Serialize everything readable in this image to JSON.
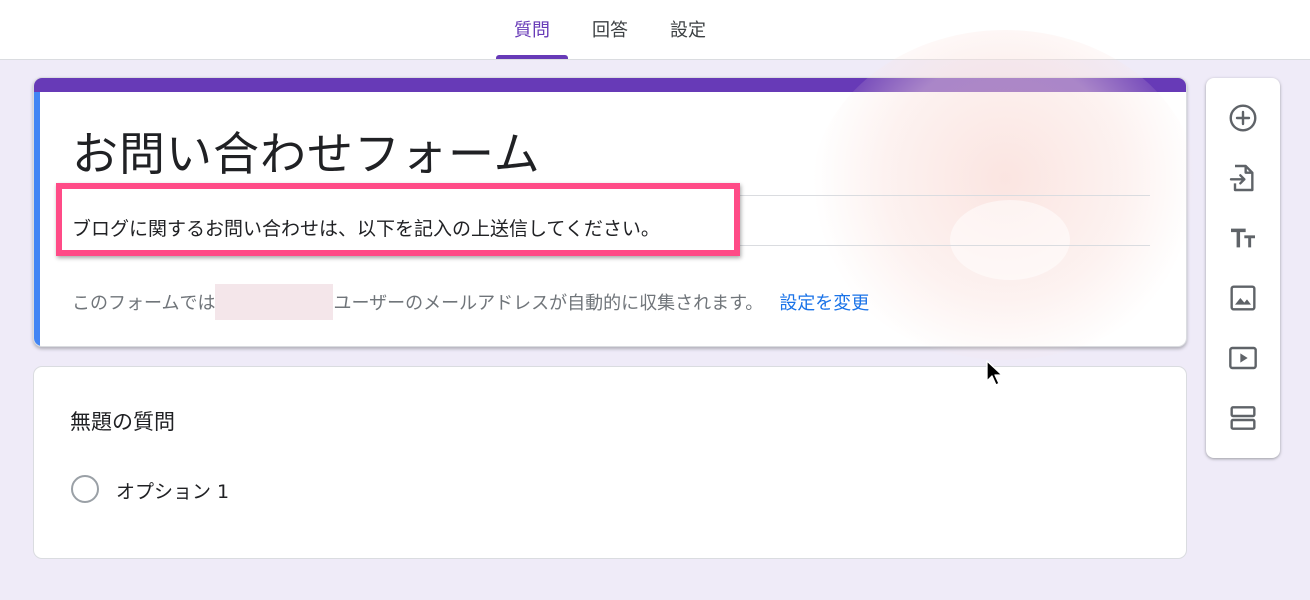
{
  "tabs": [
    {
      "label": "質問",
      "active": true
    },
    {
      "label": "回答",
      "active": false
    },
    {
      "label": "設定",
      "active": false
    }
  ],
  "form": {
    "title": "お問い合わせフォーム",
    "description": "ブログに関するお問い合わせは、以下を記入の上送信してください。",
    "email_note_prefix": "このフォームでは",
    "email_note_suffix": "ユーザーのメールアドレスが自動的に収集されます。",
    "settings_link": "設定を変更"
  },
  "question": {
    "title": "無題の質問",
    "options": [
      "オプション 1"
    ]
  },
  "toolbar": {
    "items": [
      {
        "icon": "add-circle-icon"
      },
      {
        "icon": "import-questions-icon"
      },
      {
        "icon": "add-title-icon"
      },
      {
        "icon": "add-image-icon"
      },
      {
        "icon": "add-video-icon"
      },
      {
        "icon": "add-section-icon"
      }
    ]
  },
  "colors": {
    "accent": "#673ab7",
    "header_side": "#4285f4",
    "highlight": "#ff4b87",
    "link": "#1a73e8",
    "background": "#efebf8"
  }
}
